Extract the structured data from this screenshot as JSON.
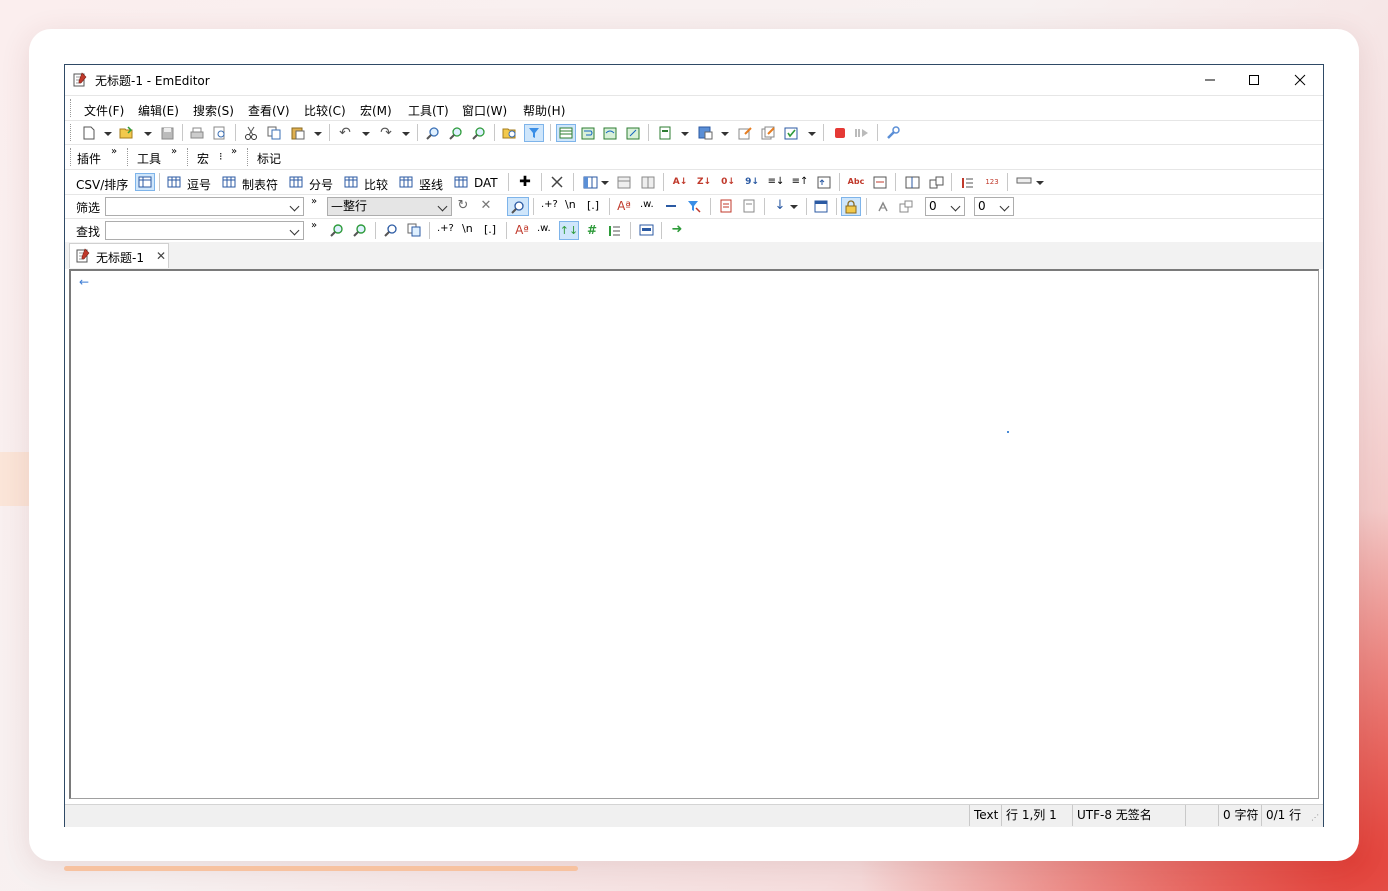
{
  "window": {
    "title": "无标题-1 - EmEditor"
  },
  "menu": [
    "文件(F)",
    "编辑(E)",
    "搜索(S)",
    "查看(V)",
    "比较(C)",
    "宏(M)",
    "工具(T)",
    "窗口(W)",
    "帮助(H)"
  ],
  "toolbar2": {
    "plugins": "插件",
    "tools": "工具",
    "macro": "宏",
    "marker": "标记"
  },
  "csvbar": {
    "csv_sort": "CSV/排序",
    "comma": "逗号",
    "tab": "制表符",
    "semicolon": "分号",
    "compare": "比较",
    "bar": "竖线",
    "dat": "DAT"
  },
  "filter": {
    "label": "筛选",
    "value": "",
    "mode": "—整行",
    "num1": "0",
    "num2": "0"
  },
  "find": {
    "label": "查找",
    "value": ""
  },
  "regex": {
    "dot": ".+?",
    "newline": "\\n",
    "bracket": "[.]",
    "word": ".w."
  },
  "tabs": [
    {
      "label": "无标题-1"
    }
  ],
  "statusbar": {
    "mode": "Text",
    "position": "行 1,列 1",
    "encoding": "UTF-8 无签名",
    "chars": "0 字符",
    "lines": "0/1 行"
  }
}
